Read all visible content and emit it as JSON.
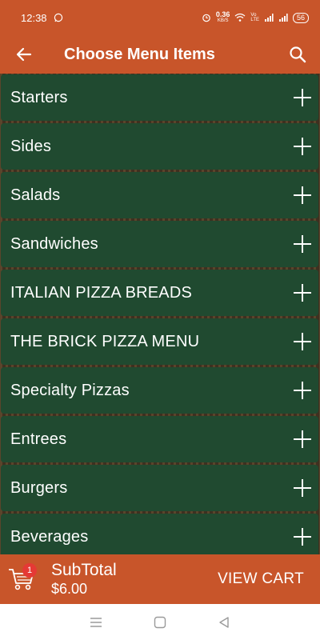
{
  "status_bar": {
    "time": "12:38",
    "net_speed": "0.36",
    "net_unit": "KB/S",
    "battery": "56"
  },
  "app_bar": {
    "title": "Choose Menu Items",
    "back_icon": "arrow-left-icon",
    "search_icon": "search-icon",
    "color": "#c8552a"
  },
  "menu": {
    "item_color": "#204a30",
    "items": [
      {
        "label": "Starters"
      },
      {
        "label": "Sides"
      },
      {
        "label": "Salads"
      },
      {
        "label": "Sandwiches"
      },
      {
        "label": "ITALIAN PIZZA BREADS"
      },
      {
        "label": "THE BRICK PIZZA MENU"
      },
      {
        "label": "Specialty Pizzas"
      },
      {
        "label": "Entrees"
      },
      {
        "label": "Burgers"
      },
      {
        "label": "Beverages"
      }
    ]
  },
  "cart": {
    "badge_count": "1",
    "subtotal_label": "SubTotal",
    "subtotal_value": "$6.00",
    "view_cart_label": "VIEW CART",
    "badge_color": "#e53935"
  },
  "system_nav": {
    "icons": [
      "menu-lines-icon",
      "home-square-icon",
      "back-triangle-icon"
    ]
  }
}
